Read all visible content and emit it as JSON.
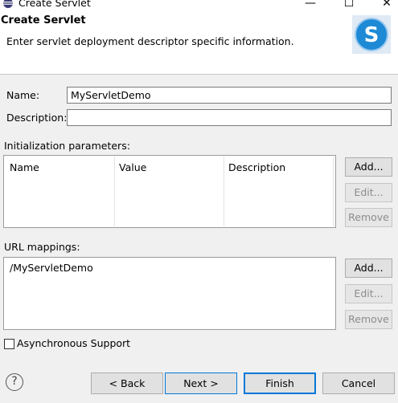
{
  "window": {
    "title": "Create Servlet",
    "controls": {
      "minimize": "—",
      "maximize": "☐",
      "close": "✕"
    }
  },
  "banner": {
    "title": "Create Servlet",
    "description": "Enter servlet deployment descriptor specific information.",
    "logo_letter": "S"
  },
  "form": {
    "name_label": "Name:",
    "name_value": "MyServletDemo",
    "description_label": "Description:",
    "description_value": ""
  },
  "init_params": {
    "label": "Initialization parameters:",
    "columns": [
      "Name",
      "Value",
      "Description"
    ],
    "buttons": {
      "add": "Add...",
      "edit": "Edit...",
      "remove": "Remove"
    }
  },
  "url_mappings": {
    "label": "URL mappings:",
    "items": [
      "/MyServletDemo"
    ],
    "buttons": {
      "add": "Add...",
      "edit": "Edit...",
      "remove": "Remove"
    }
  },
  "async": {
    "label": "Asynchronous Support",
    "checked": false
  },
  "footer": {
    "help_glyph": "?",
    "back": "< Back",
    "next": "Next >",
    "finish": "Finish",
    "cancel": "Cancel"
  },
  "colors": {
    "accent": "#0078d7",
    "logo_blue": "#1e8ad6"
  }
}
